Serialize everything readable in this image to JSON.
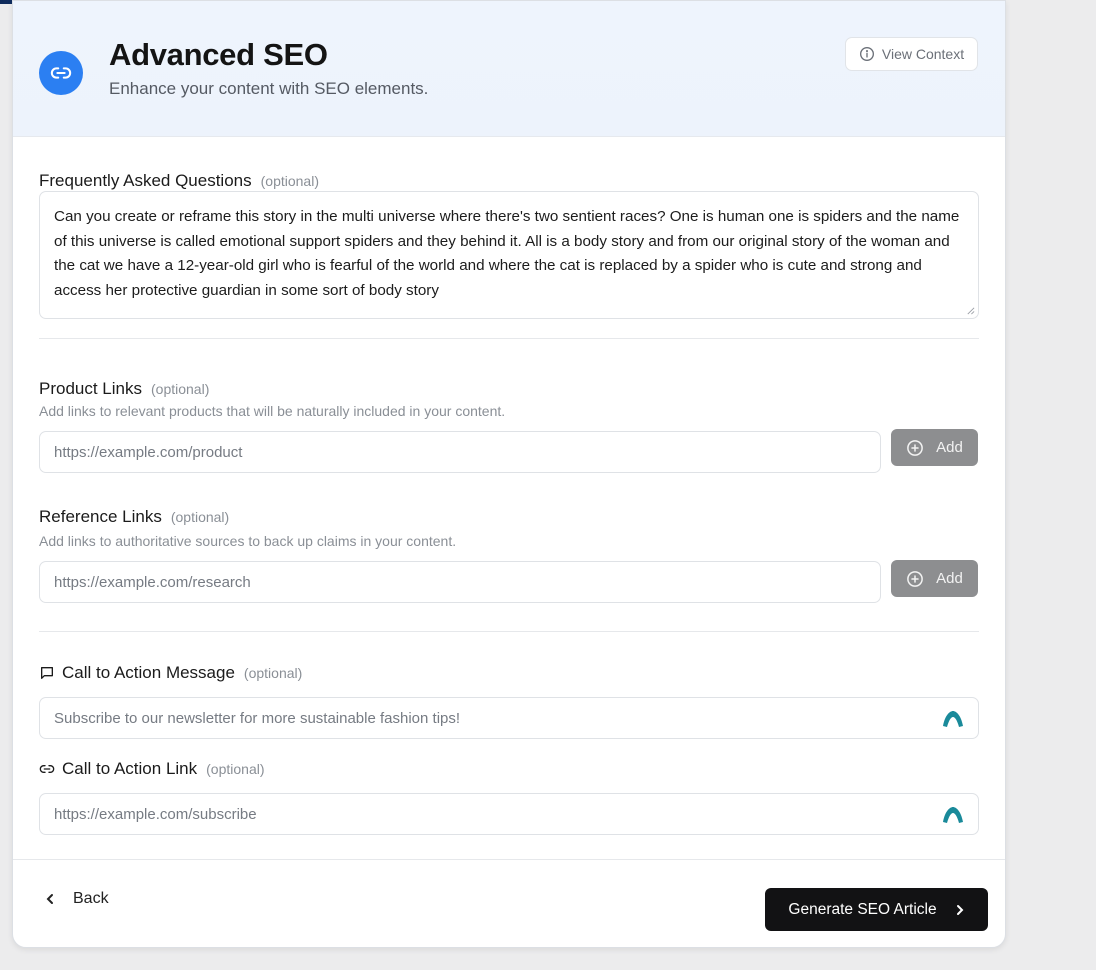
{
  "header": {
    "title": "Advanced SEO",
    "subtitle": "Enhance your content with SEO elements.",
    "view_context_label": "View Context",
    "icon": "link-icon",
    "accent_color": "#2b7ff2"
  },
  "faq": {
    "label": "Frequently Asked Questions",
    "optional": "(optional)",
    "value": "Can you create or reframe this story in the multi universe where there's two sentient races? One is human one is spiders and the name of this universe is called emotional support spiders and they behind it. All is a body story and from our original story of the woman and the cat we have a 12-year-old girl who is fearful of the world and where the cat is replaced by a spider who is cute and strong and access her protective guardian in some sort of body story"
  },
  "product_links": {
    "label": "Product Links",
    "optional": "(optional)",
    "help": "Add links to relevant products that will be naturally included in your content.",
    "placeholder": "https://example.com/product",
    "add_label": "Add"
  },
  "reference_links": {
    "label": "Reference Links",
    "optional": "(optional)",
    "help": "Add links to authoritative sources to back up claims in your content.",
    "placeholder": "https://example.com/research",
    "add_label": "Add"
  },
  "cta_message": {
    "label": "Call to Action Message",
    "optional": "(optional)",
    "placeholder": "Subscribe to our newsletter for more sustainable fashion tips!",
    "icon": "message-square-icon"
  },
  "cta_link": {
    "label": "Call to Action Link",
    "optional": "(optional)",
    "placeholder": "https://example.com/subscribe",
    "icon": "link-icon"
  },
  "footer": {
    "back_label": "Back",
    "generate_label": "Generate SEO Article"
  }
}
